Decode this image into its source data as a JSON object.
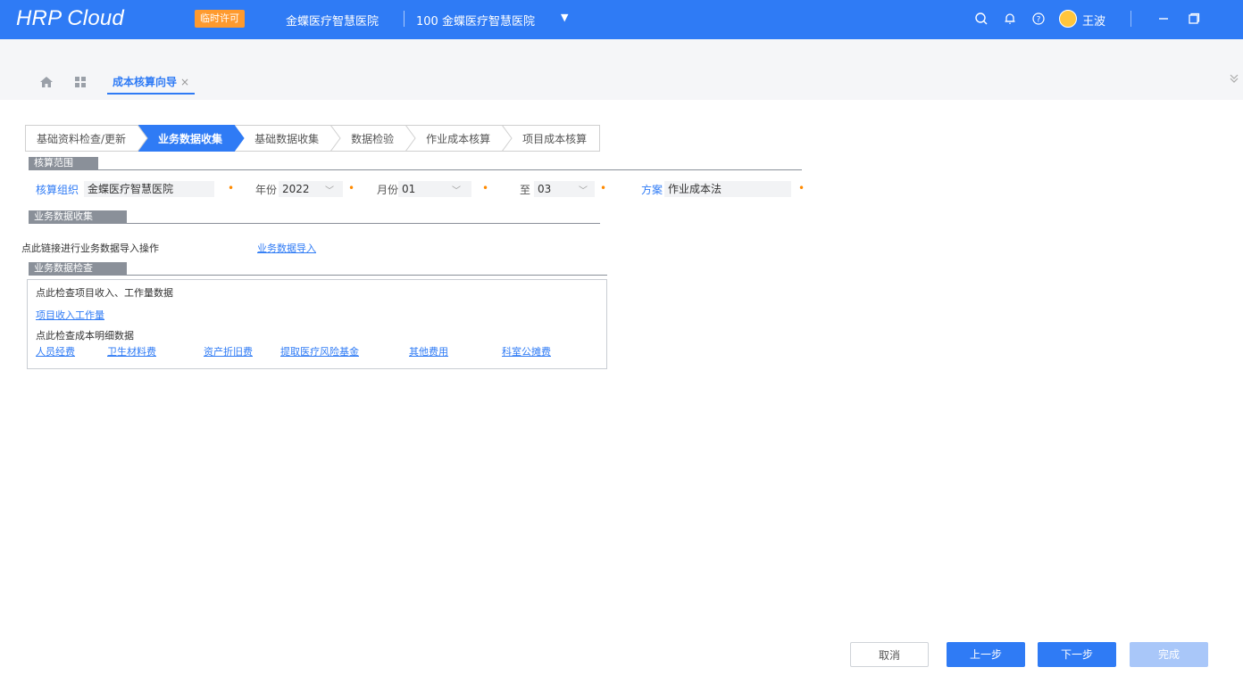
{
  "header": {
    "logo": "HRP Cloud",
    "license_badge": "临时许可",
    "org_name": "金蝶医疗智慧医院",
    "org_code_name": "100 金蝶医疗智慧医院",
    "username": "王波",
    "icons": [
      "search-icon",
      "bell-icon",
      "help-icon",
      "avatar",
      "minimize-icon",
      "restore-icon"
    ]
  },
  "tabs": {
    "active_label": "成本核算向导",
    "close": "×",
    "icons": [
      "home-icon",
      "grid-icon",
      "collapse-icon"
    ]
  },
  "steps": [
    {
      "label": "基础资料检查/更新",
      "active": false
    },
    {
      "label": "业务数据收集",
      "active": true
    },
    {
      "label": "基础数据收集",
      "active": false
    },
    {
      "label": "数据检验",
      "active": false
    },
    {
      "label": "作业成本核算",
      "active": false
    },
    {
      "label": "项目成本核算",
      "active": false
    }
  ],
  "scope": {
    "section_title": "核算范围",
    "org_label": "核算组织",
    "org_value": "金蝶医疗智慧医院",
    "year_label": "年份",
    "year_value": "2022",
    "month_label": "月份",
    "month_from": "01",
    "to_label": "至",
    "month_to": "03",
    "plan_label": "方案",
    "plan_value": "作业成本法",
    "required_mark": "•"
  },
  "collect": {
    "section_title": "业务数据收集",
    "hint": "点此链接进行业务数据导入操作",
    "link": "业务数据导入"
  },
  "check": {
    "section_title": "业务数据检查",
    "hint1": "点此检查项目收入、工作量数据",
    "link1": "项目收入工作量",
    "hint2": "点此检查成本明细数据",
    "links": [
      "人员经费",
      "卫生材料费",
      "资产折旧费",
      "提取医疗风险基金",
      "其他费用",
      "科室公摊费"
    ]
  },
  "footer": {
    "cancel": "取消",
    "prev": "上一步",
    "next": "下一步",
    "done": "完成"
  },
  "colors": {
    "primary": "#2f7bf5",
    "badge": "#ff9a2e",
    "section": "#8a9099",
    "done_disabled": "#a9c7f9"
  }
}
